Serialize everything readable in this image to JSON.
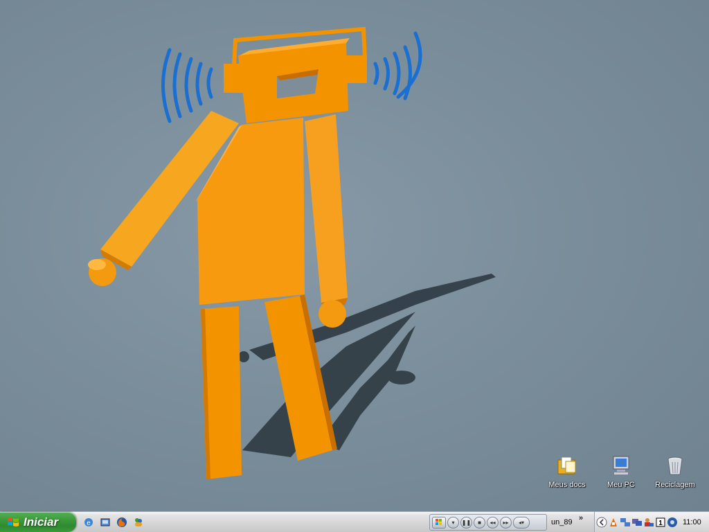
{
  "desktop": {
    "icons": [
      {
        "label": "Meus docs",
        "icon": "my-documents-icon"
      },
      {
        "label": "Meu PC",
        "icon": "my-computer-icon"
      },
      {
        "label": "Reciclagem",
        "icon": "recycle-bin-icon"
      }
    ]
  },
  "taskbar": {
    "start_label": "Iniciar",
    "quick_launch": [
      "internet-explorer-icon",
      "show-desktop-icon",
      "firefox-icon",
      "messenger-icon"
    ],
    "media_controls": [
      "media-menu-icon",
      "pause-icon",
      "stop-icon",
      "previous-icon",
      "next-icon",
      "volume-icon"
    ],
    "task_item": "un_89",
    "overflow_chevron": "»",
    "tray_icons": [
      "collapse-tray-icon",
      "app-icon",
      "network-icon",
      "display-icon",
      "user-icon",
      "box-icon",
      "update-icon"
    ],
    "clock": "11:00"
  },
  "colors": {
    "desktop_bg": "#7b8e9b",
    "figure_orange": "#f08c00",
    "sound_waves": "#1a6fd1",
    "start_green": "#3c9a3c"
  }
}
